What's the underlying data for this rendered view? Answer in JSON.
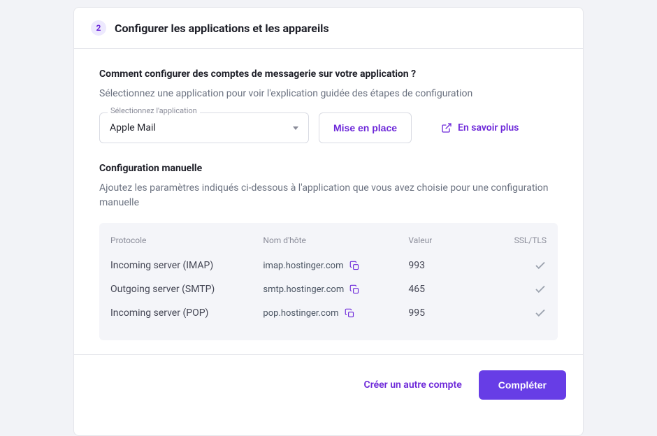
{
  "step": {
    "number": "2",
    "title": "Configurer les applications et les appareils"
  },
  "how": {
    "heading": "Comment configurer des comptes de messagerie sur votre application ?",
    "subtext": "Sélectionnez une application pour voir l'explication guidée des étapes de configuration"
  },
  "select": {
    "label": "Sélectionnez l'application",
    "value": "Apple Mail"
  },
  "setup_btn": "Mise en place",
  "learn_more": "En savoir plus",
  "manual": {
    "title": "Configuration manuelle",
    "subtext": "Ajoutez les paramètres indiqués ci-dessous à l'application que vous avez choisie pour une configuration manuelle"
  },
  "table": {
    "headers": {
      "protocol": "Protocole",
      "host": "Nom d'hôte",
      "value": "Valeur",
      "ssl": "SSL/TLS"
    },
    "rows": [
      {
        "protocol": "Incoming server (IMAP)",
        "host": "imap.hostinger.com",
        "value": "993"
      },
      {
        "protocol": "Outgoing server (SMTP)",
        "host": "smtp.hostinger.com",
        "value": "465"
      },
      {
        "protocol": "Incoming server (POP)",
        "host": "pop.hostinger.com",
        "value": "995"
      }
    ]
  },
  "footer": {
    "create_another": "Créer un autre compte",
    "complete": "Compléter"
  }
}
